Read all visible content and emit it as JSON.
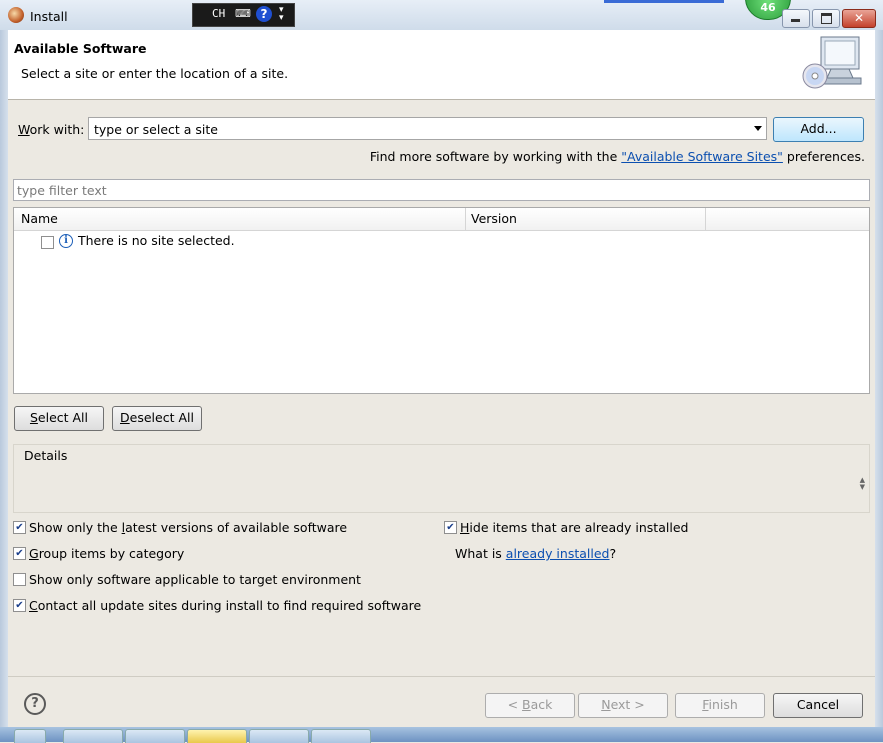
{
  "window": {
    "title": "Install",
    "badge": "46"
  },
  "ime": {
    "lang": "CH",
    "keyboard": "⌨",
    "help": "?"
  },
  "header": {
    "title": "Available Software",
    "subtitle": "Select a site or enter the location of a site."
  },
  "work_with": {
    "label_first": "W",
    "label_rest": "ork with:",
    "value": "type or select a site",
    "add_label": "Add..."
  },
  "find_more": {
    "prefix": "Find more software by working with the ",
    "link": "\"Available Software Sites\"",
    "suffix": " preferences."
  },
  "filter": {
    "placeholder": "type filter text"
  },
  "table": {
    "columns": [
      "Name",
      "Version"
    ],
    "rows": [
      {
        "text": "There is no site selected.",
        "checked": false
      }
    ]
  },
  "buttons": {
    "select_all_first": "S",
    "select_all_rest": "elect All",
    "deselect_all_first": "D",
    "deselect_all_rest": "eselect All"
  },
  "details": {
    "label": "Details"
  },
  "options": {
    "latest_a": "Show only the ",
    "latest_u": "l",
    "latest_b": "atest versions of available software",
    "group_u": "G",
    "group_b": "roup items by category",
    "applicable": "Show only software applicable to target environment",
    "contact_u": "C",
    "contact_b": "ontact all update sites during install to find required software",
    "hide_u": "H",
    "hide_b": "ide items that are already installed",
    "what_is": "What is ",
    "already_link": "already installed",
    "what_is_end": "?"
  },
  "option_states": {
    "latest": true,
    "group": true,
    "applicable": false,
    "contact": true,
    "hide": true
  },
  "nav": {
    "back_a": "< ",
    "back_u": "B",
    "back_b": "ack",
    "next_u": "N",
    "next_b": "ext >",
    "finish_u": "F",
    "finish_b": "inish",
    "cancel": "Cancel"
  }
}
